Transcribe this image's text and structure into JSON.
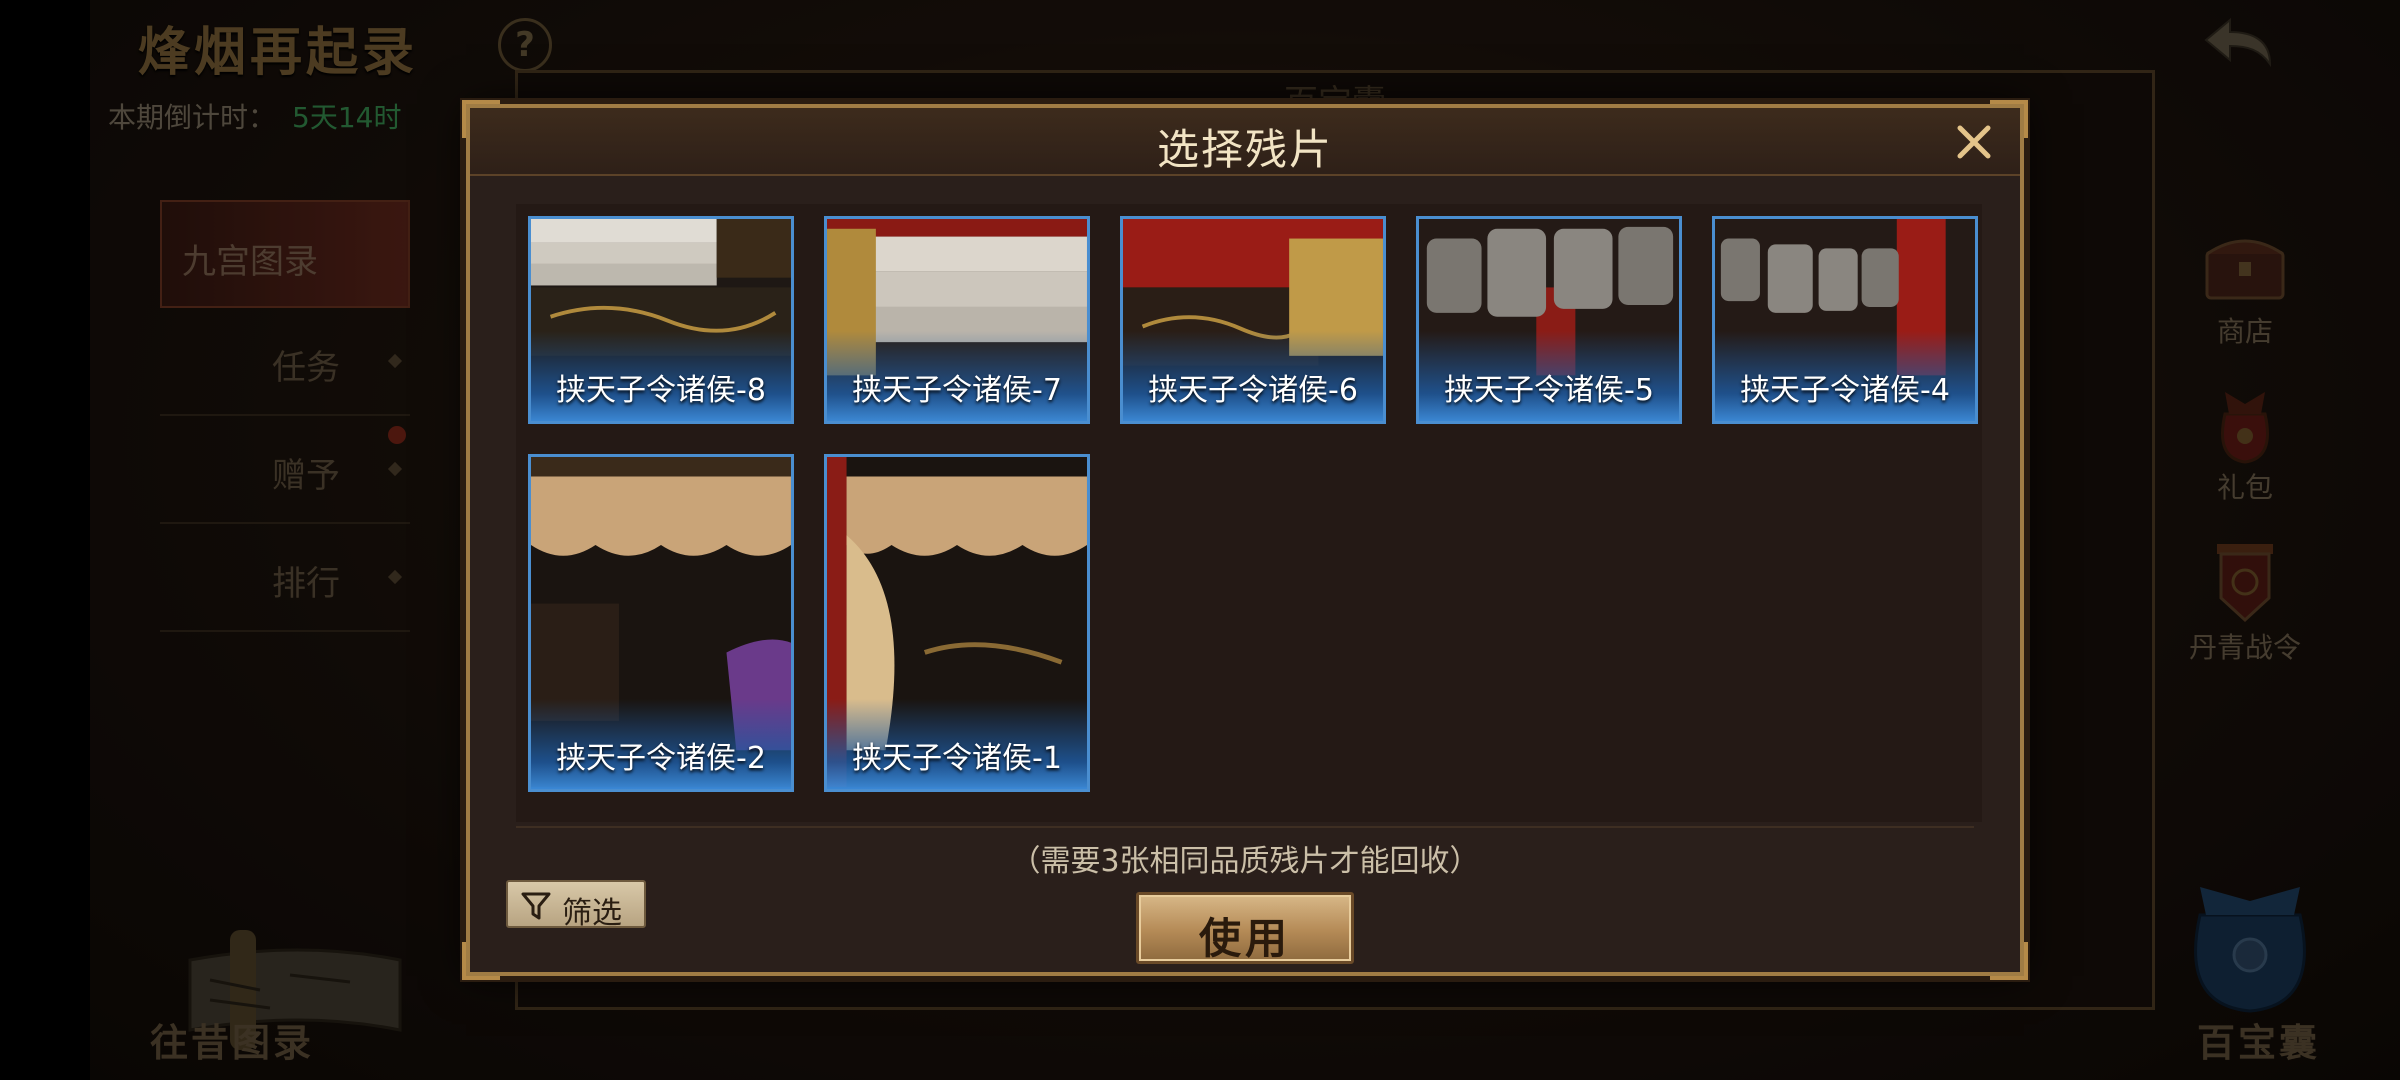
{
  "header": {
    "game_title": "烽烟再起录",
    "help": "?",
    "countdown_label": "本期倒计时：",
    "countdown_value": "5天14时"
  },
  "left_menu": [
    {
      "label": "九宫图录",
      "active": true
    },
    {
      "label": "任务"
    },
    {
      "label": "赠予",
      "badge": true
    },
    {
      "label": "排行"
    }
  ],
  "right_menu": [
    {
      "label": "商店",
      "icon": "chest-icon"
    },
    {
      "label": "礼包",
      "icon": "gift-bag-icon"
    },
    {
      "label": "丹青战令",
      "icon": "battle-pass-icon"
    }
  ],
  "bottom": {
    "left_label": "往昔图录",
    "right_label": "百宝囊"
  },
  "back_panel_title": "百宝囊",
  "modal": {
    "title": "选择残片",
    "hint": "（需要3张相同品质残片才能回收）",
    "filter_label": "筛选",
    "use_label": "使用",
    "fragments": [
      {
        "name": "挟天子令诸侯-8",
        "art": "stairs-carpet"
      },
      {
        "name": "挟天子令诸侯-7",
        "art": "stairs-pillar"
      },
      {
        "name": "挟天子令诸侯-6",
        "art": "throne-red"
      },
      {
        "name": "挟天子令诸侯-5",
        "art": "bells"
      },
      {
        "name": "挟天子令诸侯-4",
        "art": "bells-pillar"
      },
      {
        "name": "挟天子令诸侯-2",
        "art": "curtain-figure"
      },
      {
        "name": "挟天子令诸侯-1",
        "art": "curtain-drape"
      }
    ]
  },
  "colors": {
    "card_border": "#4a8ed0",
    "countdown_value": "#3fa25a",
    "modal_border": "#a07c44"
  }
}
